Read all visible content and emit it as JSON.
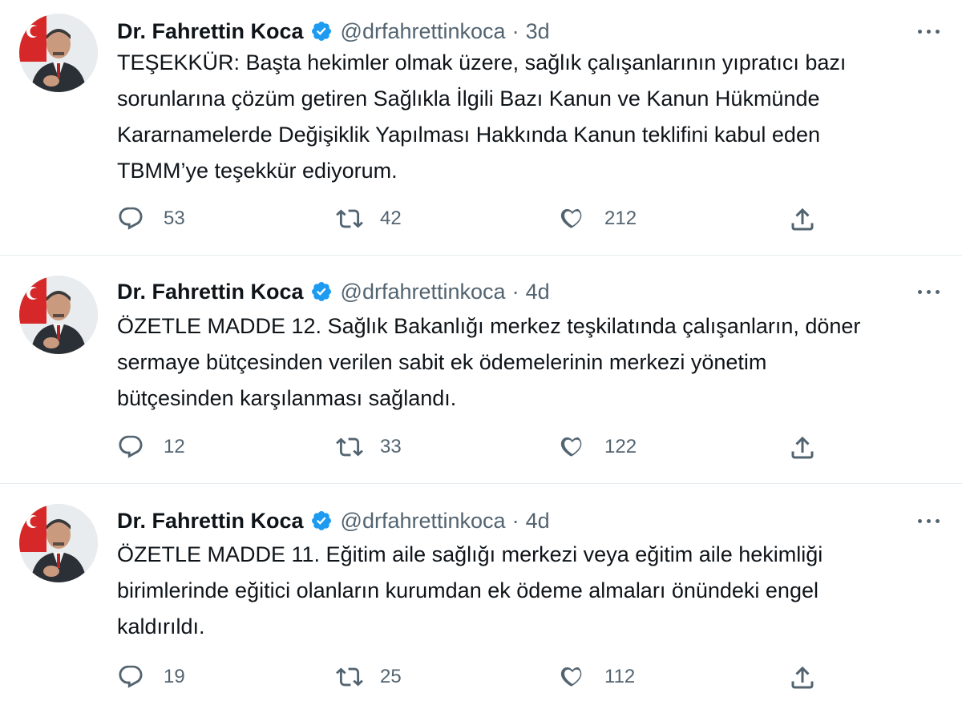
{
  "author": {
    "name": "Dr. Fahrettin Koca",
    "handle": "@drfahrettinkoca",
    "separator": "·"
  },
  "colors": {
    "text_primary": "#0f1419",
    "text_secondary": "#536471",
    "verified_blue": "#1d9bf0",
    "divider": "#e6ecf0"
  },
  "icons": {
    "reply": "reply-icon",
    "retweet": "retweet-icon",
    "like": "like-icon",
    "share": "share-icon",
    "more": "more-options-icon",
    "verified": "verified-badge-icon"
  },
  "tweets": [
    {
      "time": "3d",
      "text": "TEŞEKKÜR: Başta hekimler olmak üzere, sağlık çalışanlarının yıpratıcı bazı\nsorunlarına çözüm getiren Sağlıkla İlgili Bazı Kanun ve Kanun Hükmünde\nKararnamelerde Değişiklik Yapılması Hakkında Kanun teklifini kabul eden\nTBMM’ye teşekkür ediyorum.",
      "replies": "53",
      "retweets": "42",
      "likes": "212"
    },
    {
      "time": "4d",
      "text": "ÖZETLE MADDE 12. Sağlık Bakanlığı merkez teşkilatında çalışanların, döner\nsermaye bütçesinden verilen sabit ek ödemelerinin merkezi yönetim\nbütçesinden karşılanması sağlandı.",
      "replies": "12",
      "retweets": "33",
      "likes": "122"
    },
    {
      "time": "4d",
      "text": "ÖZETLE MADDE 11. Eğitim aile sağlığı merkezi veya eğitim aile hekimliği\nbirimlerinde eğitici olanların kurumdan ek ödeme almaları önündeki engel\nkaldırıldı.",
      "replies": "19",
      "retweets": "25",
      "likes": "112"
    }
  ]
}
